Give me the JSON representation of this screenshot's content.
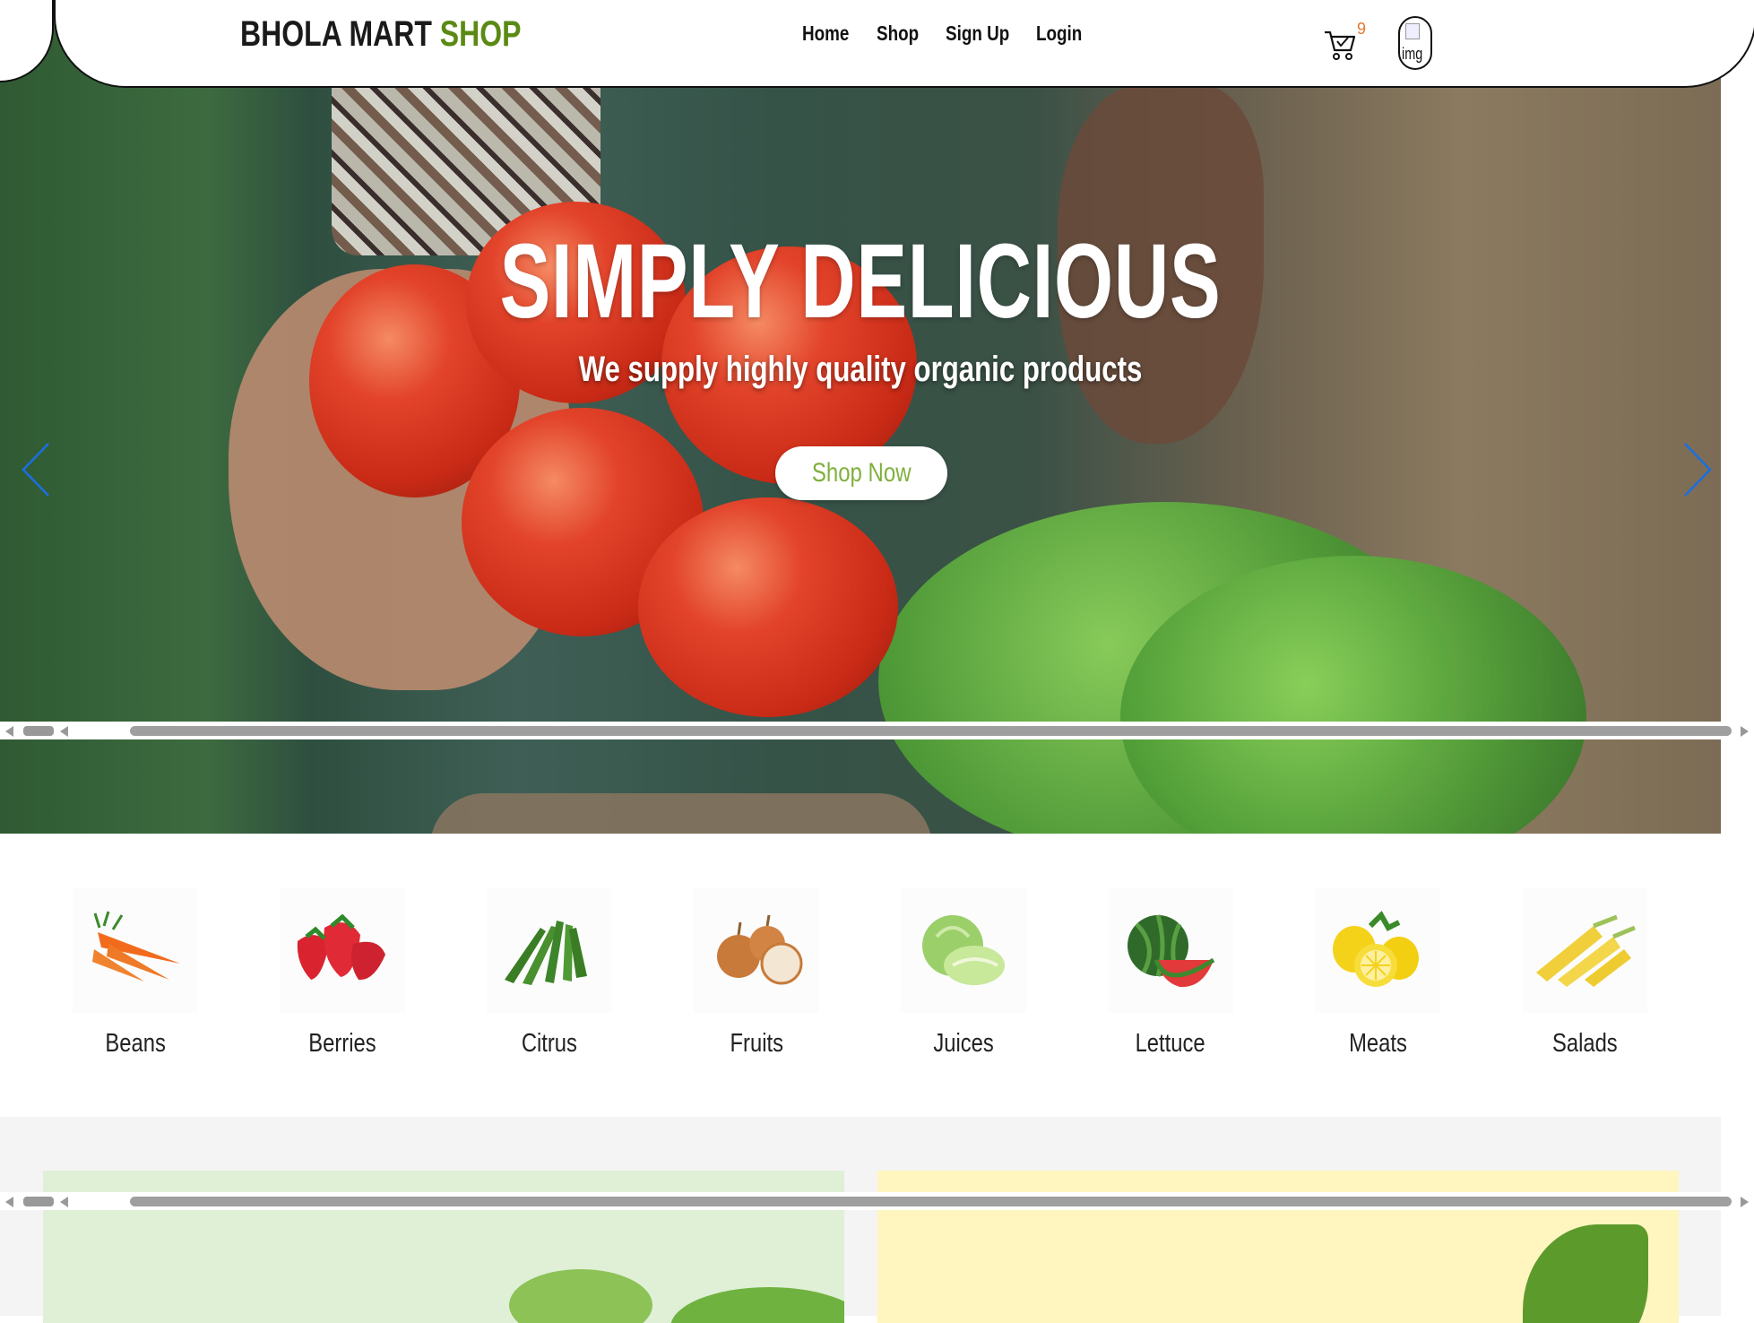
{
  "brand": {
    "name": "BHOLA MART ",
    "accent": "SHOP",
    "accent_color": "#5b8a14"
  },
  "nav": {
    "links": [
      {
        "label": "Home"
      },
      {
        "label": "Shop"
      },
      {
        "label": "Sign Up"
      },
      {
        "label": "Login"
      }
    ],
    "cart_icon": "cart-icon",
    "cart_count": "9",
    "avatar_alt": "img"
  },
  "hero": {
    "title": "SIMPLY DELICIOUS",
    "subtitle": "We supply highly quality organic products",
    "cta": "Shop Now",
    "cta_color": "#7fb03b",
    "prev_icon": "chevron-left-icon",
    "next_icon": "chevron-right-icon",
    "arrow_color": "#1a6fe0"
  },
  "categories": [
    {
      "label": "Beans",
      "icon": "carrot-icon"
    },
    {
      "label": "Berries",
      "icon": "strawberry-icon"
    },
    {
      "label": "Citrus",
      "icon": "okra-icon"
    },
    {
      "label": "Fruits",
      "icon": "onion-icon"
    },
    {
      "label": "Juices",
      "icon": "cabbage-icon"
    },
    {
      "label": "Lettuce",
      "icon": "watermelon-icon"
    },
    {
      "label": "Meats",
      "icon": "lemon-icon"
    },
    {
      "label": "Salads",
      "icon": "corn-icon"
    }
  ]
}
